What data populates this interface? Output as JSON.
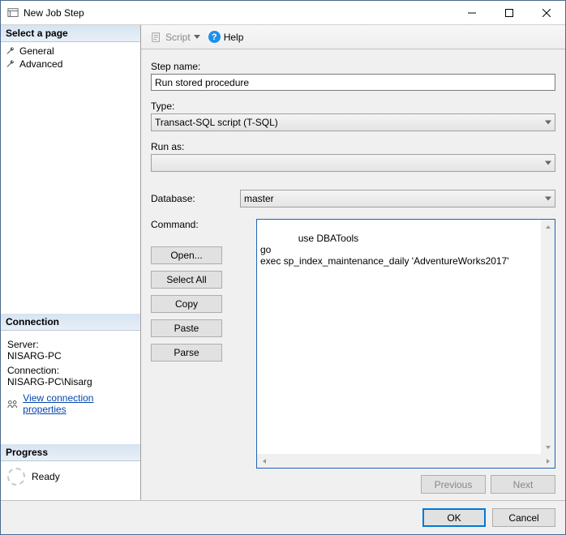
{
  "window": {
    "title": "New Job Step"
  },
  "sidebar": {
    "select_page_header": "Select a page",
    "pages": [
      {
        "label": "General"
      },
      {
        "label": "Advanced"
      }
    ],
    "connection_header": "Connection",
    "server_label": "Server:",
    "server_value": "NISARG-PC",
    "connection_label": "Connection:",
    "connection_value": "NISARG-PC\\Nisarg",
    "view_conn_props": "View connection properties",
    "progress_header": "Progress",
    "progress_status": "Ready"
  },
  "toolbar": {
    "script_label": "Script",
    "help_label": "Help"
  },
  "form": {
    "step_name_label": "Step name:",
    "step_name_value": "Run stored procedure",
    "type_label": "Type:",
    "type_value": "Transact-SQL script (T-SQL)",
    "run_as_label": "Run as:",
    "run_as_value": "",
    "database_label": "Database:",
    "database_value": "master",
    "command_label": "Command:",
    "command_value": "use DBATools\ngo\nexec sp_index_maintenance_daily 'AdventureWorks2017'",
    "buttons": {
      "open": "Open...",
      "select_all": "Select All",
      "copy": "Copy",
      "paste": "Paste",
      "parse": "Parse"
    },
    "nav": {
      "previous": "Previous",
      "next": "Next"
    }
  },
  "footer": {
    "ok": "OK",
    "cancel": "Cancel"
  }
}
